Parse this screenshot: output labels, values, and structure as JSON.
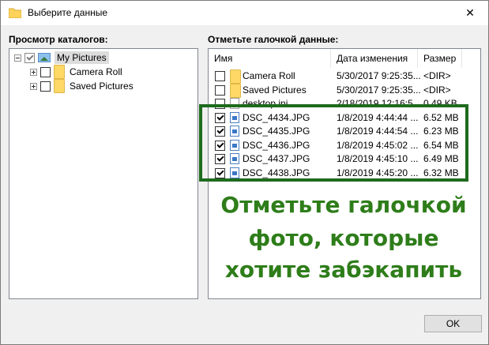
{
  "window": {
    "title": "Выберите данные",
    "close_glyph": "✕"
  },
  "left": {
    "label": "Просмотр каталогов:",
    "tree": [
      {
        "label": "My Pictures",
        "expander": "−",
        "checked": true,
        "icon": "pictures-library-icon"
      },
      {
        "label": "Camera Roll",
        "expander": "+",
        "checked": false,
        "icon": "folder-icon"
      },
      {
        "label": "Saved Pictures",
        "expander": "+",
        "checked": false,
        "icon": "folder-icon"
      }
    ]
  },
  "right": {
    "label": "Отметьте галочкой данные:",
    "columns": {
      "name": "Имя",
      "date": "Дата изменения",
      "size": "Размер"
    },
    "rows": [
      {
        "name": "Camera Roll",
        "date": "5/30/2017 9:25:35...",
        "size": "<DIR>",
        "checked": false,
        "icon": "folder-icon"
      },
      {
        "name": "Saved Pictures",
        "date": "5/30/2017 9:25:35...",
        "size": "<DIR>",
        "checked": false,
        "icon": "folder-icon"
      },
      {
        "name": "desktop.ini",
        "date": "2/18/2019 12:16:5...",
        "size": "0.49 KB",
        "checked": false,
        "icon": "file-icon"
      },
      {
        "name": "DSC_4434.JPG",
        "date": "1/8/2019 4:44:44 ...",
        "size": "6.52 MB",
        "checked": true,
        "icon": "image-file-icon"
      },
      {
        "name": "DSC_4435.JPG",
        "date": "1/8/2019 4:44:54 ...",
        "size": "6.23 MB",
        "checked": true,
        "icon": "image-file-icon"
      },
      {
        "name": "DSC_4436.JPG",
        "date": "1/8/2019 4:45:02 ...",
        "size": "6.54 MB",
        "checked": true,
        "icon": "image-file-icon"
      },
      {
        "name": "DSC_4437.JPG",
        "date": "1/8/2019 4:45:10 ...",
        "size": "6.49 MB",
        "checked": true,
        "icon": "image-file-icon"
      },
      {
        "name": "DSC_4438.JPG",
        "date": "1/8/2019 4:45:20 ...",
        "size": "6.32 MB",
        "checked": true,
        "icon": "image-file-icon"
      }
    ]
  },
  "overlay": {
    "lines": [
      "Отметьте галочкой",
      "фото, которые",
      "хотите забэкапить"
    ],
    "color": "#2e7d1a",
    "box_color": "#1e6b1e"
  },
  "buttons": {
    "ok": "OK"
  }
}
